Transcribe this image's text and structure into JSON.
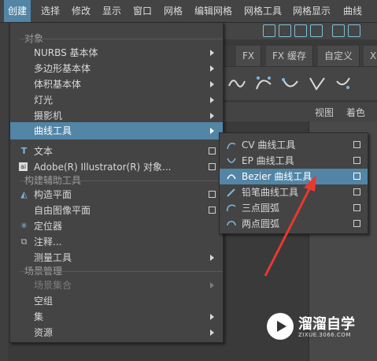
{
  "menubar": {
    "items": [
      "创建",
      "选择",
      "修改",
      "显示",
      "窗口",
      "网格",
      "编辑网格",
      "网格工具",
      "网格显示",
      "曲线"
    ],
    "active": "创建"
  },
  "tabs": [
    "FX",
    "FX 缓存",
    "自定义",
    "X"
  ],
  "view_bar": {
    "view": "视图",
    "shading": "着色"
  },
  "main_menu": {
    "rows": [
      {
        "label": "对象",
        "type": "section"
      },
      {
        "label": "NURBS 基本体",
        "arrow": true
      },
      {
        "label": "多边形基本体",
        "arrow": true
      },
      {
        "label": "体积基本体",
        "arrow": true
      },
      {
        "label": "灯光",
        "arrow": true
      },
      {
        "label": "摄影机",
        "arrow": true
      },
      {
        "label": "曲线工具",
        "arrow": true,
        "highlight": true
      },
      {
        "label": "文本",
        "check": true,
        "icon": "text-icon"
      },
      {
        "label": "Adobe(R) Illustrator(R) 对象...",
        "check": true,
        "icon": "illustrator-icon"
      },
      {
        "label": "构建辅助工具",
        "type": "section"
      },
      {
        "label": "构造平面",
        "check": true,
        "icon": "construction-plane-icon"
      },
      {
        "label": "自由图像平面",
        "check": true
      },
      {
        "label": "定位器",
        "icon": "locator-icon"
      },
      {
        "label": "注释...",
        "icon": "annotation-icon"
      },
      {
        "label": "测量工具",
        "arrow": true
      },
      {
        "label": "场景管理",
        "type": "section"
      },
      {
        "label": "场景集合",
        "arrow": true,
        "disabled": true
      },
      {
        "label": "空组"
      },
      {
        "label": "集",
        "arrow": true
      },
      {
        "label": "资源",
        "arrow": true
      }
    ]
  },
  "sub_menu": {
    "rows": [
      {
        "label": "CV 曲线工具",
        "icon": "cv-curve-icon"
      },
      {
        "label": "EP 曲线工具",
        "icon": "ep-curve-icon"
      },
      {
        "label": "Bezier 曲线工具",
        "icon": "bezier-curve-icon",
        "highlight": true
      },
      {
        "label": "铅笔曲线工具",
        "icon": "pencil-curve-icon"
      },
      {
        "label": "三点圆弧",
        "icon": "three-point-arc-icon"
      },
      {
        "label": "两点圆弧",
        "icon": "two-point-arc-icon"
      }
    ]
  },
  "watermark": {
    "title": "溜溜自学",
    "url": "ZIXUE.3066.COM"
  },
  "colors": {
    "highlight": "#5285a6",
    "menu_bg": "#444444",
    "arrow": "#e8392f"
  }
}
